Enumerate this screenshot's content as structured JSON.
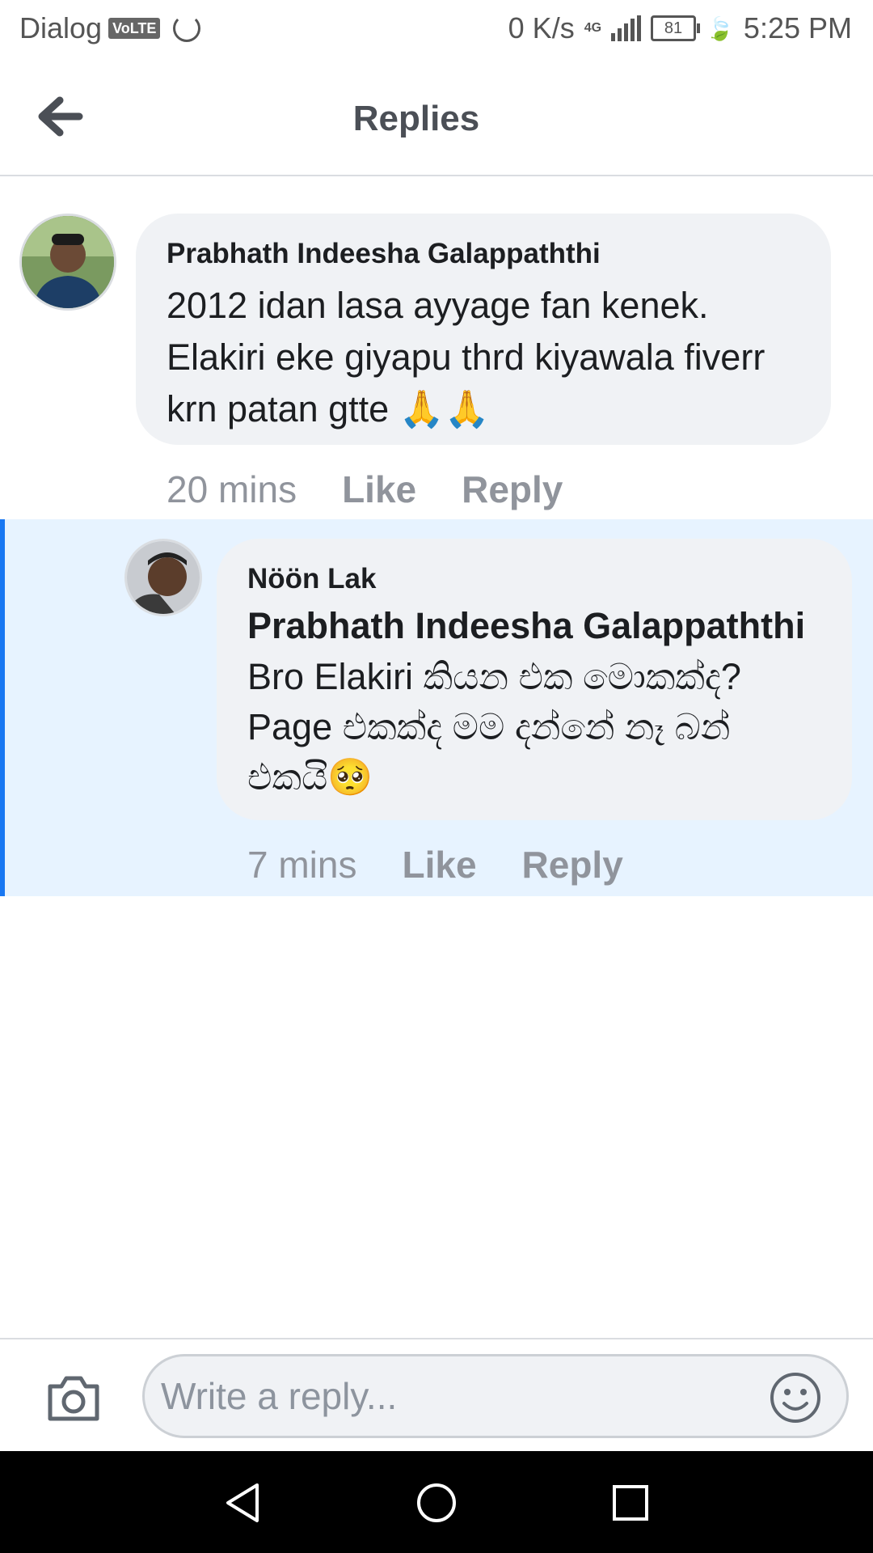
{
  "status_bar": {
    "carrier": "Dialog",
    "volte": "VoLTE",
    "speed": "0 K/s",
    "network": "4G",
    "battery": "81",
    "time": "5:25 PM"
  },
  "header": {
    "title": "Replies"
  },
  "comments": [
    {
      "author": "Prabhath Indeesha Galappaththi",
      "lines": [
        "2012 idan lasa ayyage fan kenek.",
        "Elakiri eke giyapu thrd kiyawala fiverr",
        "krn patan gtte 🙏🙏"
      ],
      "time": "20 mins",
      "like": "Like",
      "reply": "Reply"
    },
    {
      "author": "Nöön Lak",
      "mention": "Prabhath Indeesha Galappaththi",
      "lines": [
        "Bro Elakiri කියන එක මොකක්ද?",
        "Page එකක්ද මම දන්නේ නෑ බන්",
        "එකයි🥺"
      ],
      "time": "7 mins",
      "like": "Like",
      "reply": "Reply"
    }
  ],
  "composer": {
    "placeholder": "Write a reply..."
  },
  "icons": {
    "back": "back-arrow-icon",
    "camera": "camera-icon",
    "emoji": "smiley-icon",
    "nav_back": "nav-back-icon",
    "nav_home": "nav-home-icon",
    "nav_recents": "nav-recents-icon"
  },
  "colors": {
    "highlight_bg": "#e7f3ff",
    "highlight_bar": "#1877f2",
    "bubble": "#f0f2f5",
    "meta": "#90949c"
  }
}
